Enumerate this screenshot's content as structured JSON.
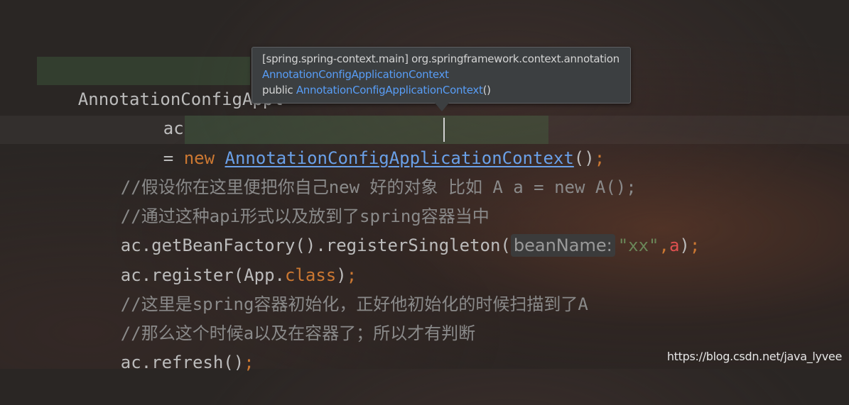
{
  "code": {
    "line1_type": "AnnotationConfigAppl",
    "line2_var": "ac",
    "line3_eq": "= ",
    "line3_new": "new",
    "line3_class": "AnnotationConfigApplicationContext",
    "line3_parens": "()",
    "line3_semi": ";",
    "line4_comment": "//假设你在这里便把你自己new 好的对象 比如 A a = new A();",
    "line5_comment": "//通过这种api形式以及放到了spring容器当中",
    "line6_call": "ac.getBeanFactory().registerSingleton(",
    "line6_hint": "beanName:",
    "line6_str": "\"xx\"",
    "line6_comma": ",",
    "line6_arg": "a",
    "line6_close": ")",
    "line6_semi": ";",
    "line7_call": "ac.register(App.",
    "line7_kw": "class",
    "line7_close": ")",
    "line7_semi": ";",
    "line8_comment": "//这里是spring容器初始化，正好他初始化的时候扫描到了A",
    "line9_comment": "//那么这个时候a以及在容器了；所以才有判断",
    "line10_call": "ac.refresh()",
    "line10_semi": ";"
  },
  "tooltip": {
    "module_line": "[spring.spring-context.main] org.springframework.context.annotation",
    "class_link": "AnnotationConfigApplicationContext",
    "modifier": "public",
    "ctor_link": "AnnotationConfigApplicationContext",
    "ctor_parens": "()"
  },
  "watermark": "https://blog.csdn.net/java_lyvee",
  "colors": {
    "background": "#2a2624",
    "keyword": "#cc7832",
    "link": "#6aa0e8",
    "comment": "#8a8a8a",
    "string": "#6a8759",
    "tooltip_bg": "#3c3f41"
  }
}
